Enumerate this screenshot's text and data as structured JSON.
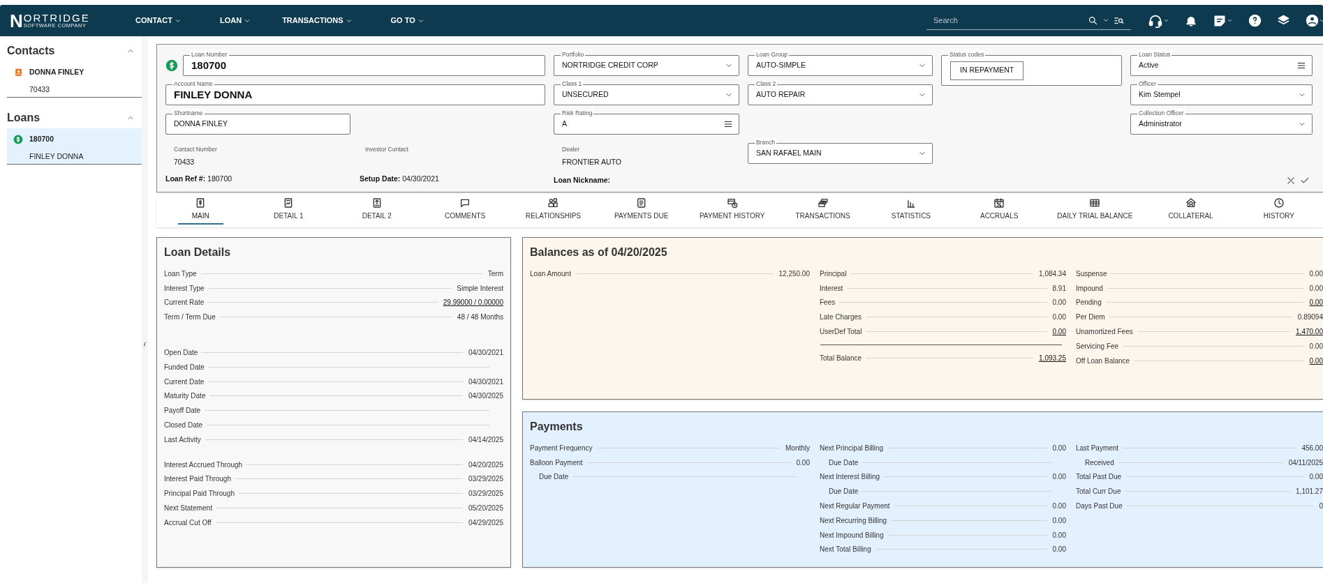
{
  "topbar": {
    "logo": {
      "initial": "N",
      "name": "ORTRIDGE",
      "tagline": "SOFTWARE COMPANY"
    },
    "nav": [
      "CONTACT",
      "LOAN",
      "TRANSACTIONS",
      "GO TO"
    ],
    "search": {
      "placeholder": "Search"
    }
  },
  "sidebar": {
    "contacts": {
      "title": "Contacts",
      "items": [
        {
          "name": "DONNA FINLEY",
          "number": "70433",
          "selected": false
        }
      ]
    },
    "loans": {
      "title": "Loans",
      "items": [
        {
          "name": "180700",
          "number": "FINLEY DONNA",
          "selected": true
        }
      ]
    }
  },
  "header": {
    "loan_number": {
      "label": "Loan Number",
      "value": "180700"
    },
    "account_name": {
      "label": "Account Name",
      "value": "FINLEY DONNA"
    },
    "shortname": {
      "label": "Shortname",
      "value": "DONNA FINLEY"
    },
    "portfolio": {
      "label": "Portfolio",
      "value": "NORTRIDGE CREDIT CORP",
      "kind": "select"
    },
    "class_1": {
      "label": "Class 1",
      "value": "UNSECURED",
      "kind": "select"
    },
    "risk_rating": {
      "label": "Risk Rating",
      "value": "A",
      "kind": "menu"
    },
    "loan_group": {
      "label": "Loan Group",
      "value": "AUTO-SIMPLE",
      "kind": "select"
    },
    "class_2": {
      "label": "Class 2",
      "value": "AUTO REPAIR",
      "kind": "select"
    },
    "branch": {
      "label": "Branch",
      "value": "SAN RAFAEL MAIN",
      "kind": "select"
    },
    "status_codes": {
      "label": "Status codes",
      "codes": [
        "IN REPAYMENT"
      ]
    },
    "loan_status": {
      "label": "Loan Status",
      "value": "Active",
      "kind": "menu"
    },
    "officer": {
      "label": "Officer",
      "value": "Kim Stempel",
      "kind": "select"
    },
    "collection_officer": {
      "label": "Collection Officer",
      "value": "Administrator",
      "kind": "select"
    },
    "contact_number": {
      "label": "Contact Number",
      "value": "70433"
    },
    "investor_contact": {
      "label": "Investor Contact"
    },
    "dealer": {
      "label": "Dealer",
      "value": "FRONTIER AUTO"
    },
    "loan_ref": {
      "label": "Loan Ref #:",
      "value": "180700"
    },
    "setup_date": {
      "label": "Setup Date:",
      "value": "04/30/2021"
    },
    "loan_nickname": {
      "label": "Loan Nickname:"
    }
  },
  "tabs": [
    {
      "label": "MAIN",
      "selected": true
    },
    {
      "label": "DETAIL 1",
      "selected": false
    },
    {
      "label": "DETAIL 2",
      "selected": false
    },
    {
      "label": "COMMENTS",
      "selected": false
    },
    {
      "label": "RELATIONSHIPS",
      "selected": false
    },
    {
      "label": "PAYMENTS DUE",
      "selected": false
    },
    {
      "label": "PAYMENT HISTORY",
      "selected": false
    },
    {
      "label": "TRANSACTIONS",
      "selected": false
    },
    {
      "label": "STATISTICS",
      "selected": false
    },
    {
      "label": "ACCRUALS",
      "selected": false
    },
    {
      "label": "DAILY TRIAL BALANCE",
      "selected": false
    },
    {
      "label": "COLLATERAL",
      "selected": false
    },
    {
      "label": "HISTORY",
      "selected": false
    }
  ],
  "loan_details": {
    "title": "Loan Details",
    "groups": [
      {
        "rows": [
          {
            "kind": "row",
            "label": "Loan Type",
            "value": "Term"
          },
          {
            "kind": "row",
            "label": "Interest Type",
            "value": "Simple Interest"
          },
          {
            "kind": "row",
            "label": "Current Rate",
            "value": "29.99000 / 0.00000",
            "link": true
          },
          {
            "kind": "row",
            "label": "Term / Term Due",
            "value": "48 / 48 Months"
          }
        ]
      },
      {
        "rows": [
          {
            "kind": "row",
            "label": "Open Date",
            "value": "04/30/2021"
          },
          {
            "kind": "row",
            "label": "Funded Date"
          },
          {
            "kind": "row",
            "label": "Current Date",
            "value": "04/30/2021"
          },
          {
            "kind": "row",
            "label": "Maturity Date",
            "value": "04/30/2025"
          },
          {
            "kind": "row",
            "label": "Payoff Date"
          },
          {
            "kind": "row",
            "label": "Closed Date"
          },
          {
            "kind": "row",
            "label": "Last Activity",
            "value": "04/14/2025"
          }
        ]
      },
      {
        "rows": [
          {
            "kind": "row",
            "label": "Interest Accrued Through",
            "value": "04/20/2025"
          },
          {
            "kind": "row",
            "label": "Interest Paid Through",
            "value": "03/29/2025"
          },
          {
            "kind": "row",
            "label": "Principal Paid Through",
            "value": "03/29/2025"
          },
          {
            "kind": "row",
            "label": "Next Statement",
            "value": "05/20/2025"
          },
          {
            "kind": "row",
            "label": "Accrual Cut Off",
            "value": "04/29/2025"
          }
        ]
      }
    ]
  },
  "balances": {
    "title": "Balances as of 04/20/2025",
    "columns": [
      {
        "rows": [
          {
            "kind": "row",
            "label": "Loan Amount",
            "value": "12,250.00"
          }
        ]
      },
      {
        "rows": [
          {
            "kind": "row",
            "label": "Principal",
            "value": "1,084.34"
          },
          {
            "kind": "row",
            "label": "Interest",
            "value": "8.91"
          },
          {
            "kind": "row",
            "label": "Fees",
            "value": "0.00"
          },
          {
            "kind": "row",
            "label": "Late Charges",
            "value": "0.00"
          },
          {
            "kind": "row",
            "label": "UserDef Total",
            "value": "0.00",
            "link": true
          },
          {
            "kind": "rule"
          },
          {
            "kind": "row",
            "label": "Total Balance",
            "value": "1,093.25",
            "link": true
          }
        ]
      },
      {
        "rows": [
          {
            "kind": "row",
            "label": "Suspense",
            "value": "0.00"
          },
          {
            "kind": "row",
            "label": "Impound",
            "value": "0.00"
          },
          {
            "kind": "row",
            "label": "Pending",
            "value": "0.00",
            "link": true
          },
          {
            "kind": "row",
            "label": "Per Diem",
            "value": "0.89094"
          },
          {
            "kind": "row",
            "label": "Unamortized Fees",
            "value": "1,470.00",
            "link": true
          },
          {
            "kind": "row",
            "label": "Servicing Fee",
            "value": "0.00"
          },
          {
            "kind": "row",
            "label": "Off Loan Balance",
            "value": "0.00",
            "link": true
          }
        ]
      }
    ]
  },
  "payments": {
    "title": "Payments",
    "columns": [
      {
        "rows": [
          {
            "kind": "row",
            "label": "Payment Frequency",
            "value": "Monthly"
          },
          {
            "kind": "row",
            "label": "Balloon Payment",
            "value": "0.00"
          },
          {
            "kind": "sub",
            "label": "Due Date"
          }
        ]
      },
      {
        "rows": [
          {
            "kind": "row",
            "label": "Next Principal Billing",
            "value": "0.00"
          },
          {
            "kind": "sub",
            "label": "Due Date"
          },
          {
            "kind": "row",
            "label": "Next Interest Billing",
            "value": "0.00"
          },
          {
            "kind": "sub",
            "label": "Due Date"
          },
          {
            "kind": "row",
            "label": "Next Regular Payment",
            "value": "0.00"
          },
          {
            "kind": "row",
            "label": "Next Recurring Billing",
            "value": "0.00"
          },
          {
            "kind": "row",
            "label": "Next Impound Billing",
            "value": "0.00"
          },
          {
            "kind": "row",
            "label": "Next Total Billing",
            "value": "0.00"
          }
        ]
      },
      {
        "rows": [
          {
            "kind": "row",
            "label": "Last Payment",
            "value": "456.00"
          },
          {
            "kind": "sub",
            "label": "Received",
            "value": "04/11/2025"
          },
          {
            "kind": "row",
            "label": "Total Past Due",
            "value": "0.00"
          },
          {
            "kind": "row",
            "label": "Total Curr Due",
            "value": "1,101.27"
          },
          {
            "kind": "row",
            "label": "Days Past Due",
            "value": "0"
          }
        ]
      }
    ]
  }
}
